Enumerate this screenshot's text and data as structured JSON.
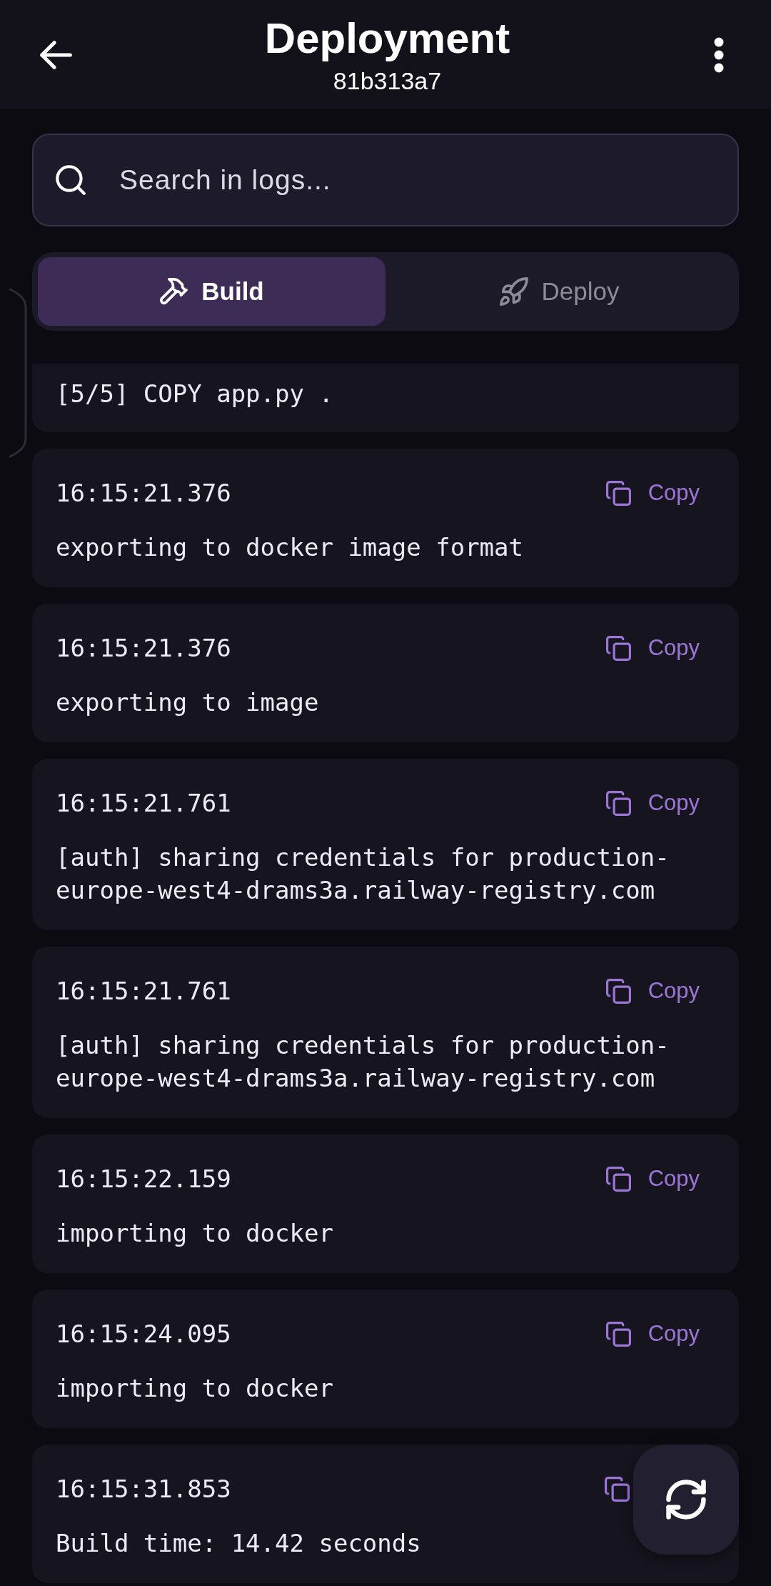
{
  "header": {
    "title": "Deployment",
    "subtitle": "81b313a7"
  },
  "search": {
    "placeholder": "Search in logs..."
  },
  "tabs": [
    {
      "kind": "build",
      "label": "Build",
      "selected": true
    },
    {
      "kind": "deploy",
      "label": "Deploy",
      "selected": false
    }
  ],
  "logs": [
    {
      "message": "[5/5] COPY app.py ."
    },
    {
      "time": "16:15:21.376",
      "copy_label": "Copy",
      "message": "exporting to docker image format"
    },
    {
      "time": "16:15:21.376",
      "copy_label": "Copy",
      "message": "exporting to image"
    },
    {
      "time": "16:15:21.761",
      "copy_label": "Copy",
      "message": "[auth] sharing credentials for production-europe-west4-drams3a.railway-registry.com"
    },
    {
      "time": "16:15:21.761",
      "copy_label": "Copy",
      "message": "[auth] sharing credentials for production-europe-west4-drams3a.railway-registry.com"
    },
    {
      "time": "16:15:22.159",
      "copy_label": "Copy",
      "message": "importing to docker"
    },
    {
      "time": "16:15:24.095",
      "copy_label": "Copy",
      "message": "importing to docker"
    },
    {
      "time": "16:15:31.853",
      "message": "Build time: 14.42 seconds"
    }
  ]
}
